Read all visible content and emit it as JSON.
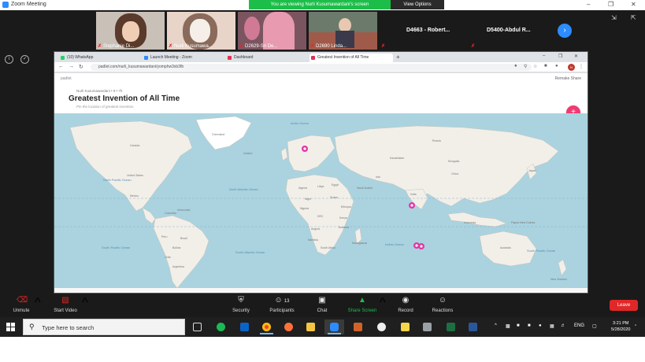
{
  "zoom": {
    "window_title": "Zoom Meeting",
    "banner": "You are viewing Nurli Kusumawardani's screen",
    "view_options": "View Options",
    "participants": [
      {
        "name": "Stephanie Di..."
      },
      {
        "name": "Nurli Kusumawa..."
      },
      {
        "name": "D2629-Sri De..."
      },
      {
        "name": "D2690 Linda..."
      }
    ],
    "name_tiles": [
      {
        "name": "D4663 - Robert..."
      },
      {
        "name": "D5400-Abdul R..."
      }
    ]
  },
  "browser": {
    "tabs": [
      {
        "label": "(10) WhatsApp"
      },
      {
        "label": "Launch Meeting - Zoom"
      },
      {
        "label": "Dashboard"
      },
      {
        "label": "Greatest Invention of All Time"
      }
    ],
    "url": "padlet.com/nurli_kusumawardani/yomphw3xb3fb",
    "profile_initials": "N",
    "page": {
      "logo": "padlet",
      "tools": "Remake  Share",
      "author": "Nurli Kusumawardani • 9 • 7h",
      "title": "Greatest Invention of All Time",
      "subtitle": "Pin the location of greatest invention",
      "map_labels": {
        "oceans": [
          "North Pacific Ocean",
          "North Atlantic Ocean",
          "South Pacific Ocean",
          "South Atlantic Ocean",
          "Indian Ocean",
          "South Pacific Ocean",
          "Arctic Ocean"
        ],
        "regions": [
          "Greenland",
          "Canada",
          "United States",
          "Mexico",
          "Brazil",
          "Peru",
          "Argentina",
          "Russia",
          "Kazakhstan",
          "China",
          "India",
          "Mongolia",
          "Iran",
          "Saudi Arabia",
          "Algeria",
          "Libya",
          "Egypt",
          "Niger",
          "Sudan",
          "Nigeria",
          "Ethiopia",
          "DRC",
          "Angola",
          "Namibia",
          "South Africa",
          "Madagascar",
          "Australia",
          "Indonesia",
          "Papua New Guinea",
          "New Zealand",
          "Kenya",
          "Tanzania",
          "Iceland",
          "Colombia",
          "Venezuela",
          "Bolivia",
          "Chile",
          "Japan"
        ]
      }
    }
  },
  "toolbar": {
    "unmute": "Unmute",
    "start_video": "Start Video",
    "security": "Security",
    "participants": "Participants",
    "participant_count": "13",
    "chat": "Chat",
    "share_screen": "Share Screen",
    "record": "Record",
    "reactions": "Reactions",
    "leave": "Leave"
  },
  "taskbar": {
    "search_placeholder": "Type here to search",
    "tray_lang": "ENG",
    "time": "3:21 PM",
    "date": "5/28/2020"
  }
}
